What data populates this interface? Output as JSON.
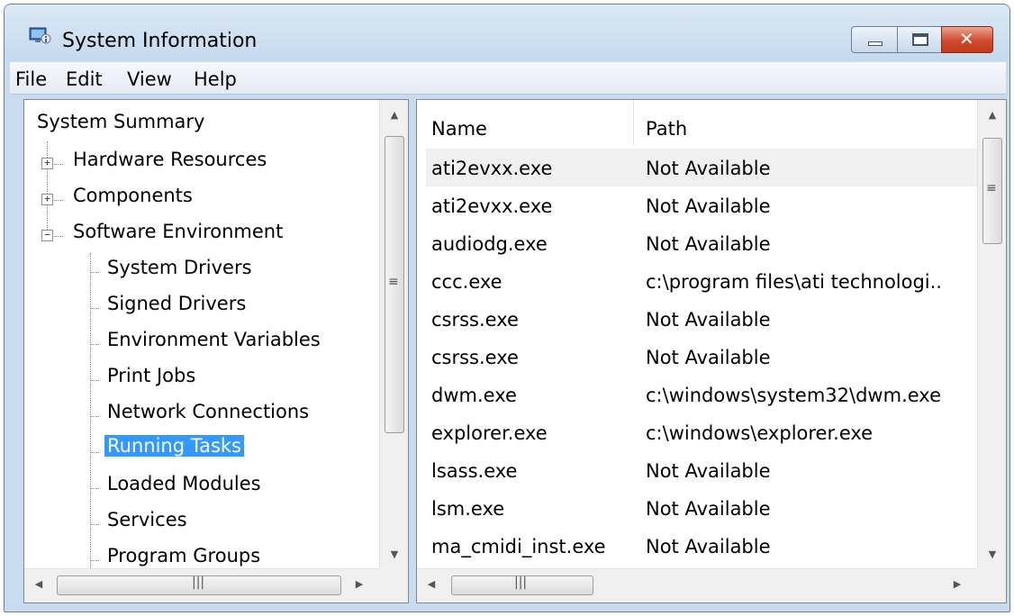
{
  "window": {
    "title": "System Information",
    "icon": "system-information-icon"
  },
  "menu": [
    "File",
    "Edit",
    "View",
    "Help"
  ],
  "tree": {
    "root": "System Summary",
    "top_items": [
      {
        "label": "Hardware Resources",
        "expander": "+"
      },
      {
        "label": "Components",
        "expander": "+"
      },
      {
        "label": "Software Environment",
        "expander": "−"
      }
    ],
    "children": [
      "System Drivers",
      "Signed Drivers",
      "Environment Variables",
      "Print Jobs",
      "Network Connections",
      "Running Tasks",
      "Loaded Modules",
      "Services",
      "Program Groups"
    ],
    "selected": "Running Tasks"
  },
  "table": {
    "columns": [
      "Name",
      "Path"
    ],
    "rows": [
      [
        "ati2evxx.exe",
        "Not Available"
      ],
      [
        "ati2evxx.exe",
        "Not Available"
      ],
      [
        "audiodg.exe",
        "Not Available"
      ],
      [
        "ccc.exe",
        "c:\\program files\\ati technologi.."
      ],
      [
        "csrss.exe",
        "Not Available"
      ],
      [
        "csrss.exe",
        "Not Available"
      ],
      [
        "dwm.exe",
        "c:\\windows\\system32\\dwm.exe"
      ],
      [
        "explorer.exe",
        "c:\\windows\\explorer.exe"
      ],
      [
        "lsass.exe",
        "Not Available"
      ],
      [
        "lsm.exe",
        "Not Available"
      ],
      [
        "ma_cmidi_inst.exe",
        "Not Available"
      ]
    ]
  },
  "colors": {
    "selection": "#3399ff",
    "frame": "#c9dcef",
    "close_button": "#cf4a2d"
  }
}
